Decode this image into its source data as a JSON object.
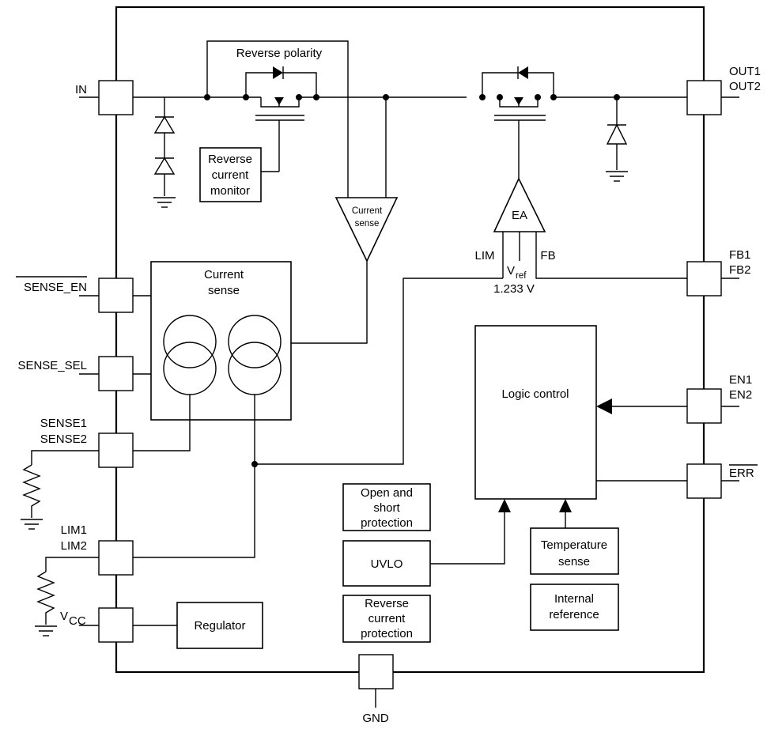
{
  "diagram": {
    "type": "functional block diagram",
    "pins": {
      "in": "IN",
      "out": [
        "OUT1",
        "OUT2"
      ],
      "sense_en": "SENSE_EN",
      "sense_sel": "SENSE_SEL",
      "sense": [
        "SENSE1",
        "SENSE2"
      ],
      "lim": [
        "LIM1",
        "LIM2"
      ],
      "vcc_main": "V",
      "vcc_sub": "CC",
      "fb": [
        "FB1",
        "FB2"
      ],
      "en": [
        "EN1",
        "EN2"
      ],
      "err": "ERR",
      "gnd": "GND"
    },
    "blocks": {
      "reverse_polarity": "Reverse polarity",
      "reverse_current_monitor": [
        "Reverse",
        "current",
        "monitor"
      ],
      "current_sense_amp": [
        "Current",
        "sense"
      ],
      "current_sense_block": [
        "Current",
        "sense"
      ],
      "ea": "EA",
      "ea_inputs": {
        "lim": "LIM",
        "fb": "FB",
        "vref_main": "V",
        "vref_sub": "ref",
        "vref_value": "1.233 V"
      },
      "logic_control": "Logic control",
      "open_short_protection": [
        "Open and",
        "short",
        "protection"
      ],
      "uvlo": "UVLO",
      "reverse_current_protection": [
        "Reverse",
        "current",
        "protection"
      ],
      "temperature_sense": [
        "Temperature",
        "sense"
      ],
      "internal_reference": [
        "Internal",
        "reference"
      ],
      "regulator": "Regulator"
    }
  }
}
